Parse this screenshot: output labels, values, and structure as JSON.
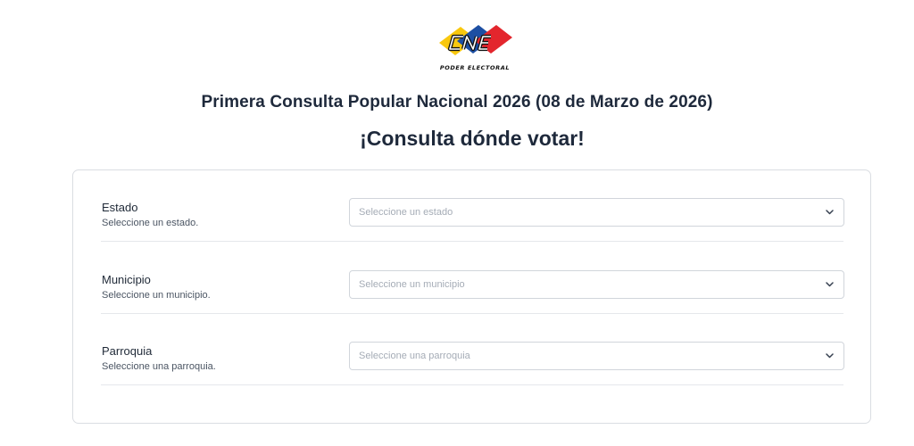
{
  "logo": {
    "wordmark": "CNE",
    "tagline": "PODER ELECTORAL",
    "colors": {
      "yellow": "#f9c80e",
      "blue": "#1d4fa3",
      "red": "#e3262d"
    }
  },
  "header": {
    "title": "Primera Consulta Popular Nacional 2026 (08 de Marzo de 2026)",
    "subtitle": "¡Consulta dónde votar!"
  },
  "form": {
    "fields": [
      {
        "label": "Estado",
        "help": "Seleccione un estado.",
        "placeholder": "Seleccione un estado"
      },
      {
        "label": "Municipio",
        "help": "Seleccione un municipio.",
        "placeholder": "Seleccione un municipio"
      },
      {
        "label": "Parroquia",
        "help": "Seleccione una parroquia.",
        "placeholder": "Seleccione una parroquia"
      }
    ]
  },
  "icons": {
    "select_arrow": "chevron-down-icon"
  }
}
